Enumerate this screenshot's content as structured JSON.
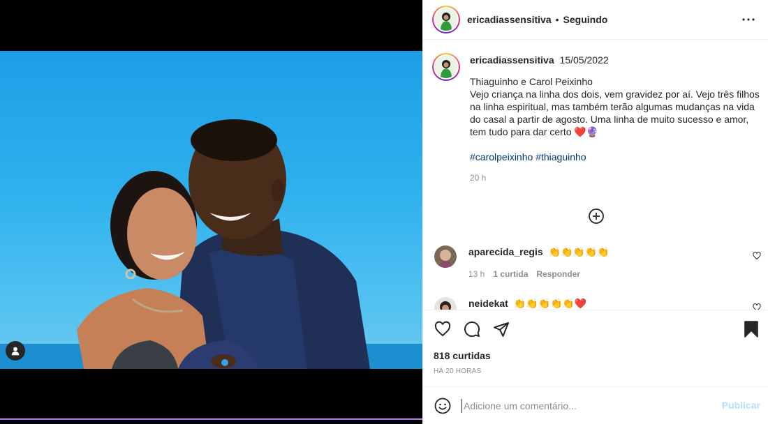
{
  "post": {
    "author": "ericadiassensitiva",
    "separator": "•",
    "follow_status": "Seguindo",
    "caption": {
      "username": "ericadiassensitiva",
      "date": "15/05/2022",
      "text": "Thiaguinho e Carol Peixinho\nVejo criança na linha dos dois, vem gravidez por aí. Vejo três filhos na linha espiritual, mas também terão algumas mudanças na vida do casal a partir de agosto. Uma linha de muito sucesso e amor, tem tudo para dar certo ❤️🔮",
      "hashtags": [
        "#carolpeixinho",
        "#thiaguinho"
      ],
      "time": "20 h"
    },
    "comments": [
      {
        "username": "aparecida_regis",
        "text": "👏👏👏👏👏",
        "time": "13 h",
        "likes": "1 curtida",
        "reply": "Responder"
      },
      {
        "username": "neidekat",
        "text": "👏👏👏👏👏❤️"
      }
    ],
    "likes_count": "818 curtidas",
    "posted_ago": "HÁ 20 HORAS"
  },
  "add_comment": {
    "placeholder": "Adicione um comentário...",
    "publish_label": "Publicar"
  },
  "icons": {
    "more": "more-horizontal-icon",
    "load_more": "plus-circle-icon",
    "like": "heart-icon",
    "comment": "comment-icon",
    "share": "send-icon",
    "save": "bookmark-icon",
    "emoji": "emoji-icon",
    "user_tag": "user-tag-icon"
  },
  "colors": {
    "link": "#00376b",
    "muted": "#8e8e8e",
    "publish_disabled": "#b2dffc",
    "heart_red": "#ed4956"
  }
}
